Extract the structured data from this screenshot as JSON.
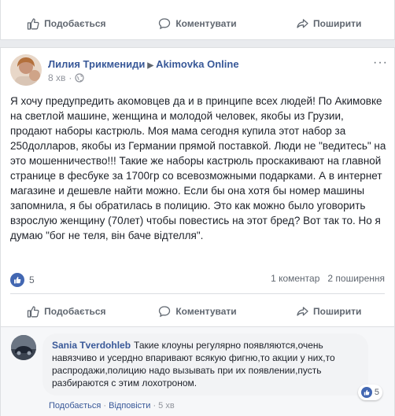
{
  "top_actions": {
    "like": "Подобається",
    "comment": "Коментувати",
    "share": "Поширити"
  },
  "post": {
    "author": "Лилия Трикмениди",
    "group": "Akimovka Online",
    "time": "8 хв",
    "body": "Я хочу предупредить акомовцев да и в принципе всех людей! По Акимовке на светлой машине, женщина и молодой человек, якобы из Грузии, продают наборы кастрюль. Моя мама сегодня купила этот набор за 250долларов, якобы из Германии прямой поставкой. Люди не \"ведитесь\" на это мошенничество!!! Такие же наборы кастрюль проскакивают на главной странице в фесбуке за 1700гр со всевозможными подарками. А в интернет магазине и дешевле найти можно. Если бы она хотя бы номер машины запомнила, я бы обратилась в полицию. Это как можно было уговорить взрослую женщину (70лет) чтобы повестись на этот бред? Вот так то. Но я думаю \"бог не теля, він баче відтелля\".",
    "reactions_count": "5",
    "comments_count": "1 коментар",
    "shares_count": "2 поширення",
    "actions": {
      "like": "Подобається",
      "comment": "Коментувати",
      "share": "Поширити"
    }
  },
  "comment": {
    "author": "Sania Tverdohleb",
    "text": "Такие клоуны регулярно появляются,очень навязчиво и усердно впаривают всякую фигню,то акции у них,то распродажи,полицию надо вызывать при их появлении,пусть разбираются с этим лохотроном.",
    "reactions_count": "5",
    "like_link": "Подобається",
    "reply_link": "Відповісти",
    "dot1": "·",
    "dot2": "·",
    "time": "5 хв"
  },
  "colors": {
    "link": "#385898",
    "muted": "#606770",
    "like_blue": "#4267b2"
  }
}
